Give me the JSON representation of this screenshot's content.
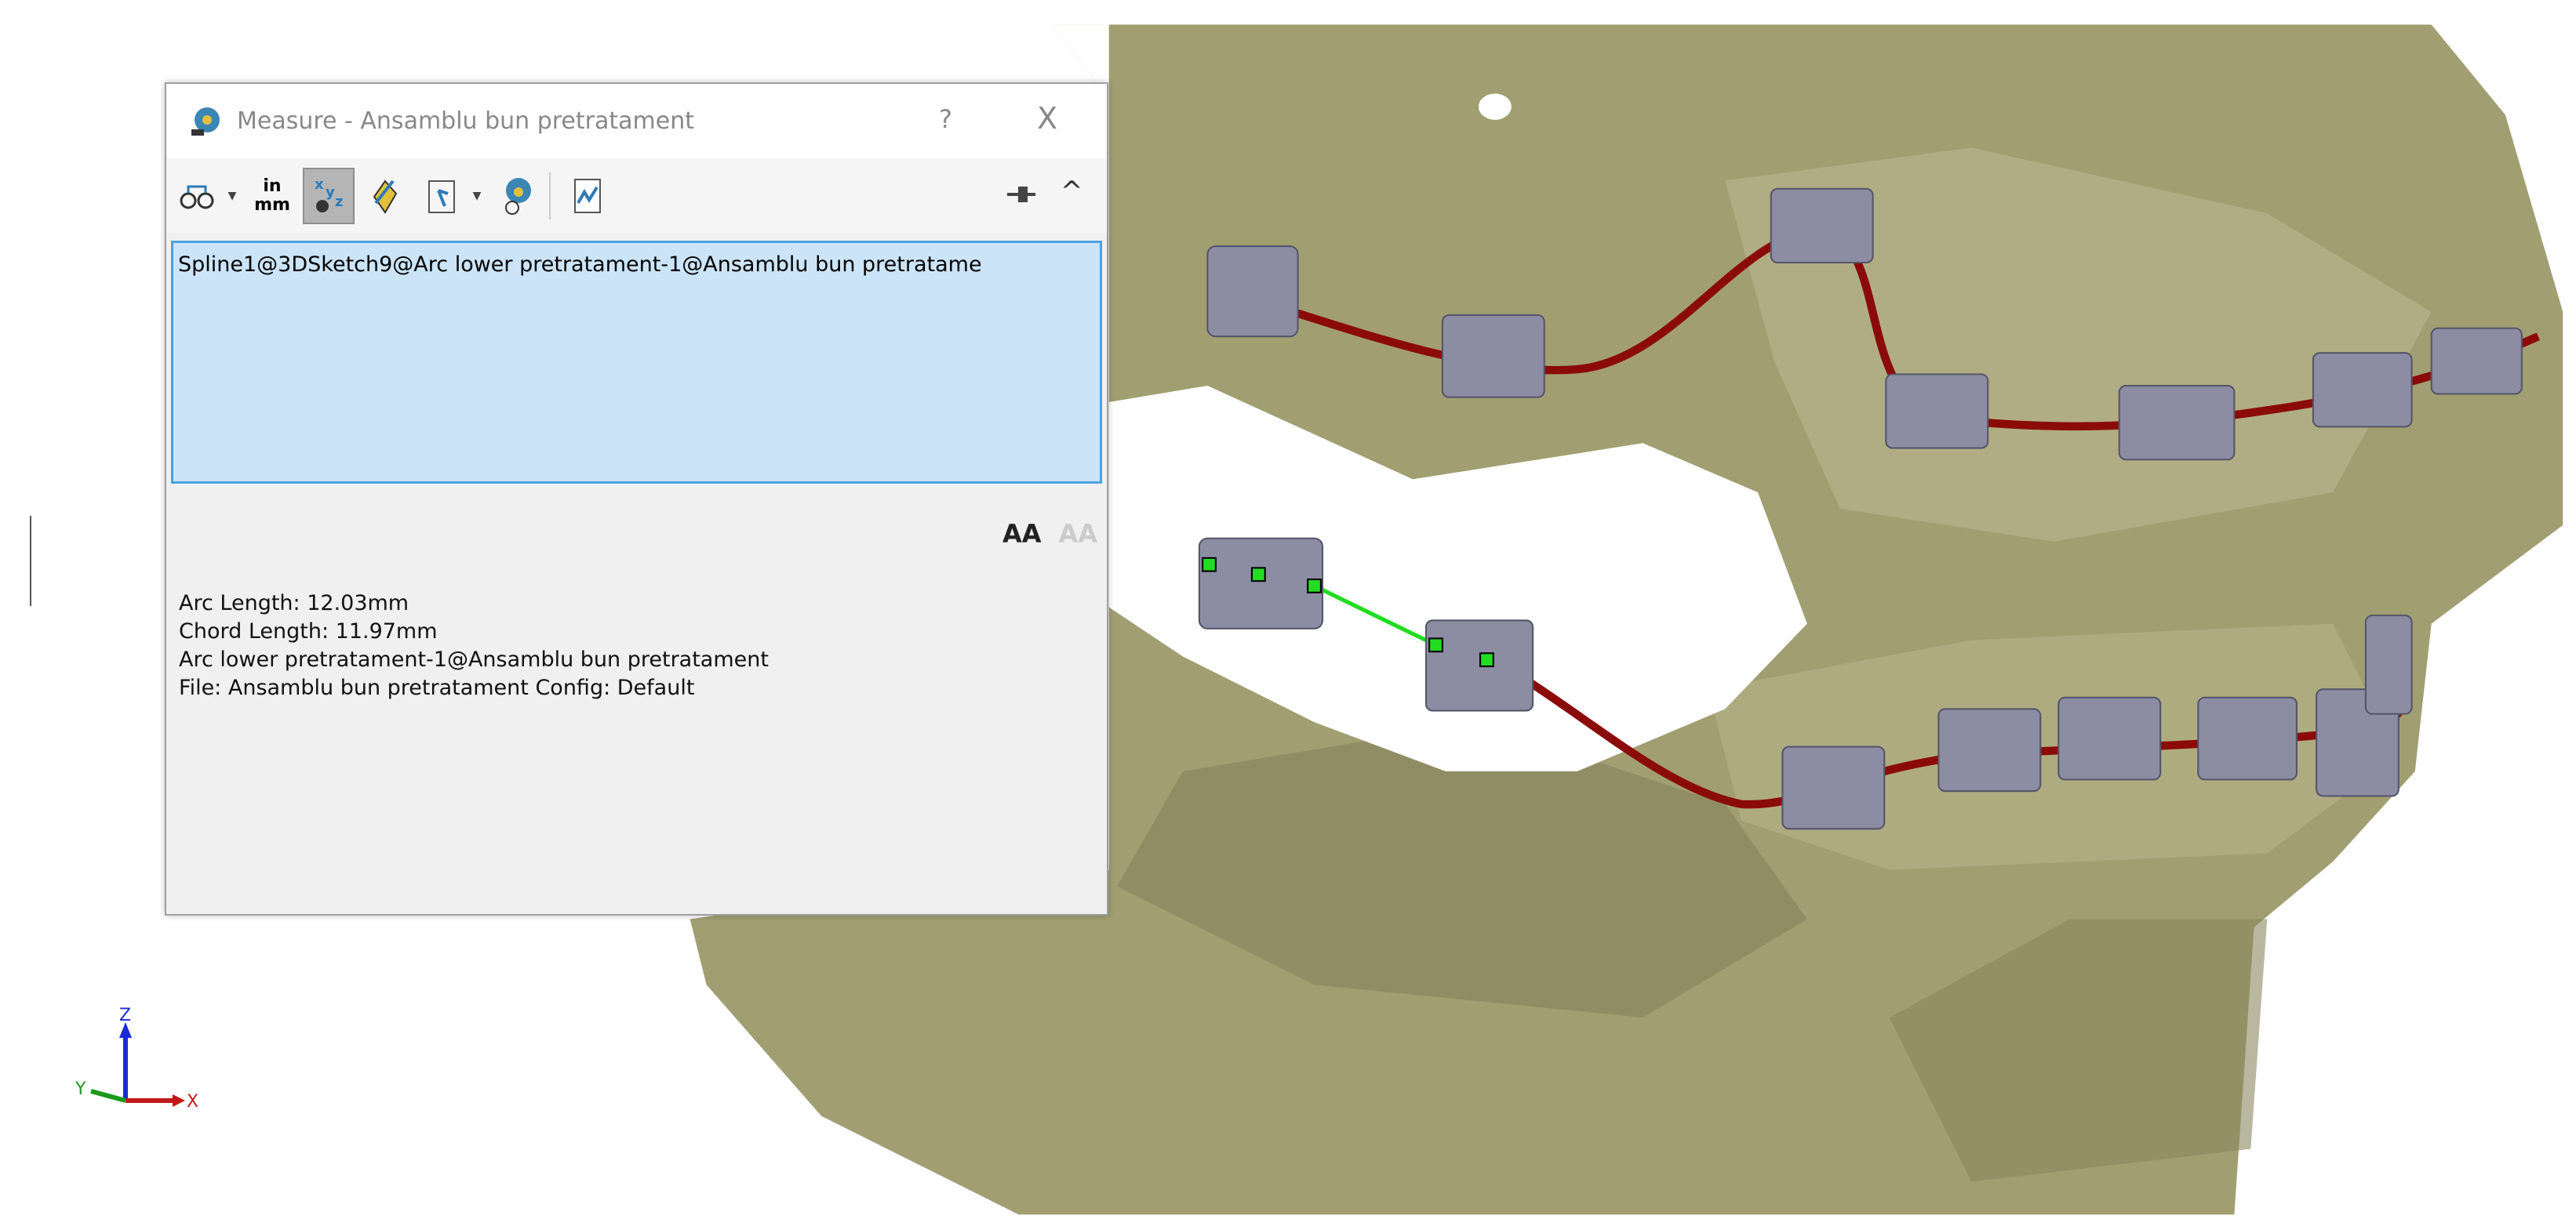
{
  "dialog": {
    "title": "Measure - Ansamblu bun pretratament",
    "help_label": "?",
    "close_label": "X",
    "toolbar": {
      "items": [
        {
          "icon": "arc-circle-measure-icon",
          "dropdown": true
        },
        {
          "icon": "units-precision-icon",
          "label_top": "in",
          "label_bottom": "mm"
        },
        {
          "icon": "show-xyz-icon",
          "active": true
        },
        {
          "icon": "point-to-point-icon"
        },
        {
          "icon": "projection-icon",
          "dropdown": true
        },
        {
          "icon": "create-sensor-icon"
        },
        {
          "icon": "measurement-history-icon"
        }
      ],
      "pin_icon": "pin-icon",
      "collapse_icon": "chevron-up-icon",
      "collapse_label": "^"
    },
    "selection": "Spline1@3DSketch9@Arc lower pretratament-1@Ansamblu bun pretratame",
    "font_buttons": {
      "increase": "AA",
      "decrease": "AA"
    },
    "results": [
      "Arc Length: 12.03mm",
      "Chord Length: 11.97mm",
      "Arc lower pretratament-1@Ansamblu bun pretratament",
      "File: Ansamblu bun pretratament Config: Default"
    ]
  },
  "triad": {
    "x": "X",
    "y": "Y",
    "z": "Z"
  },
  "colors": {
    "model": "#a19e72",
    "wire": "#8b0a0a",
    "bracket": "#8c8ca3",
    "highlight": "#22dd22"
  }
}
